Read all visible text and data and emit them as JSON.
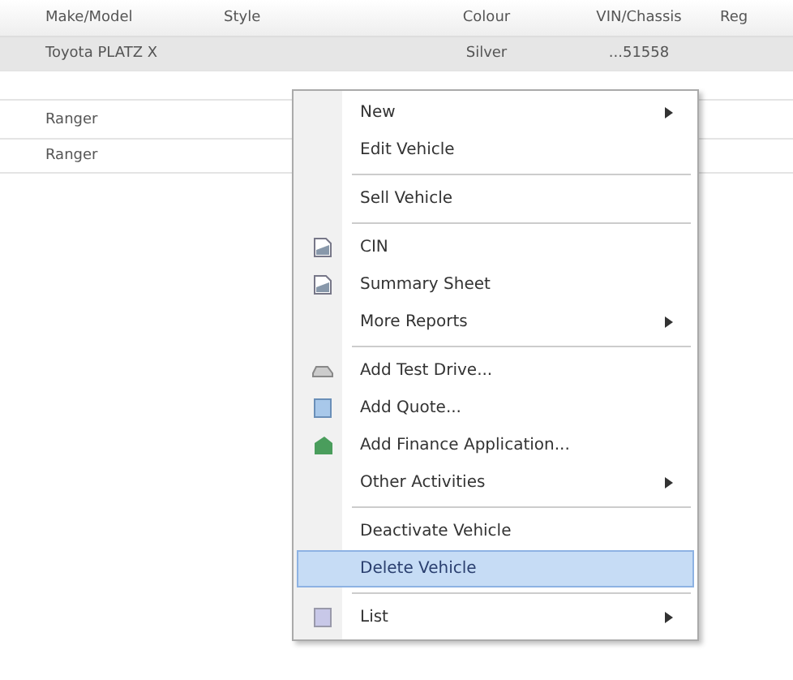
{
  "table": {
    "columns": [
      "Make/Model",
      "Style",
      "Colour",
      "VIN/Chassis",
      "Reg"
    ],
    "rows": [
      {
        "cells": [
          "Toyota PLATZ X",
          "",
          "Silver",
          "...51558",
          ""
        ],
        "selected": true
      },
      {
        "cells": [
          "",
          "",
          "",
          "",
          ""
        ],
        "selected": false
      },
      {
        "cells": [
          "Ranger",
          "",
          "",
          "",
          ""
        ],
        "selected": false
      },
      {
        "cells": [
          "Ranger",
          "",
          "",
          "",
          ""
        ],
        "selected": false
      }
    ]
  },
  "context_menu": {
    "items": [
      {
        "kind": "plain",
        "label": "New",
        "submenu": true,
        "selected": false
      },
      {
        "kind": "plain",
        "label": "Edit Vehicle",
        "submenu": false,
        "selected": false
      },
      {
        "kind": "separator"
      },
      {
        "kind": "plain",
        "label": "Sell Vehicle",
        "submenu": false,
        "selected": false
      },
      {
        "kind": "separator"
      },
      {
        "kind": "document",
        "label": "CIN",
        "submenu": false,
        "selected": false
      },
      {
        "kind": "document",
        "label": "Summary Sheet",
        "submenu": false,
        "selected": false
      },
      {
        "kind": "plain",
        "label": "More Reports",
        "submenu": true,
        "selected": false
      },
      {
        "kind": "separator"
      },
      {
        "kind": "car",
        "label": "Add Test Drive...",
        "submenu": false,
        "selected": false
      },
      {
        "kind": "quote",
        "label": "Add Quote...",
        "submenu": false,
        "selected": false
      },
      {
        "kind": "finance",
        "label": "Add Finance Application...",
        "submenu": false,
        "selected": false
      },
      {
        "kind": "plain",
        "label": "Other Activities",
        "submenu": true,
        "selected": false
      },
      {
        "kind": "separator"
      },
      {
        "kind": "plain",
        "label": "Deactivate Vehicle",
        "submenu": false,
        "selected": false
      },
      {
        "kind": "plain",
        "label": "Delete Vehicle",
        "submenu": false,
        "selected": true
      },
      {
        "kind": "separator"
      },
      {
        "kind": "list",
        "label": "List",
        "submenu": true,
        "selected": false
      }
    ]
  }
}
